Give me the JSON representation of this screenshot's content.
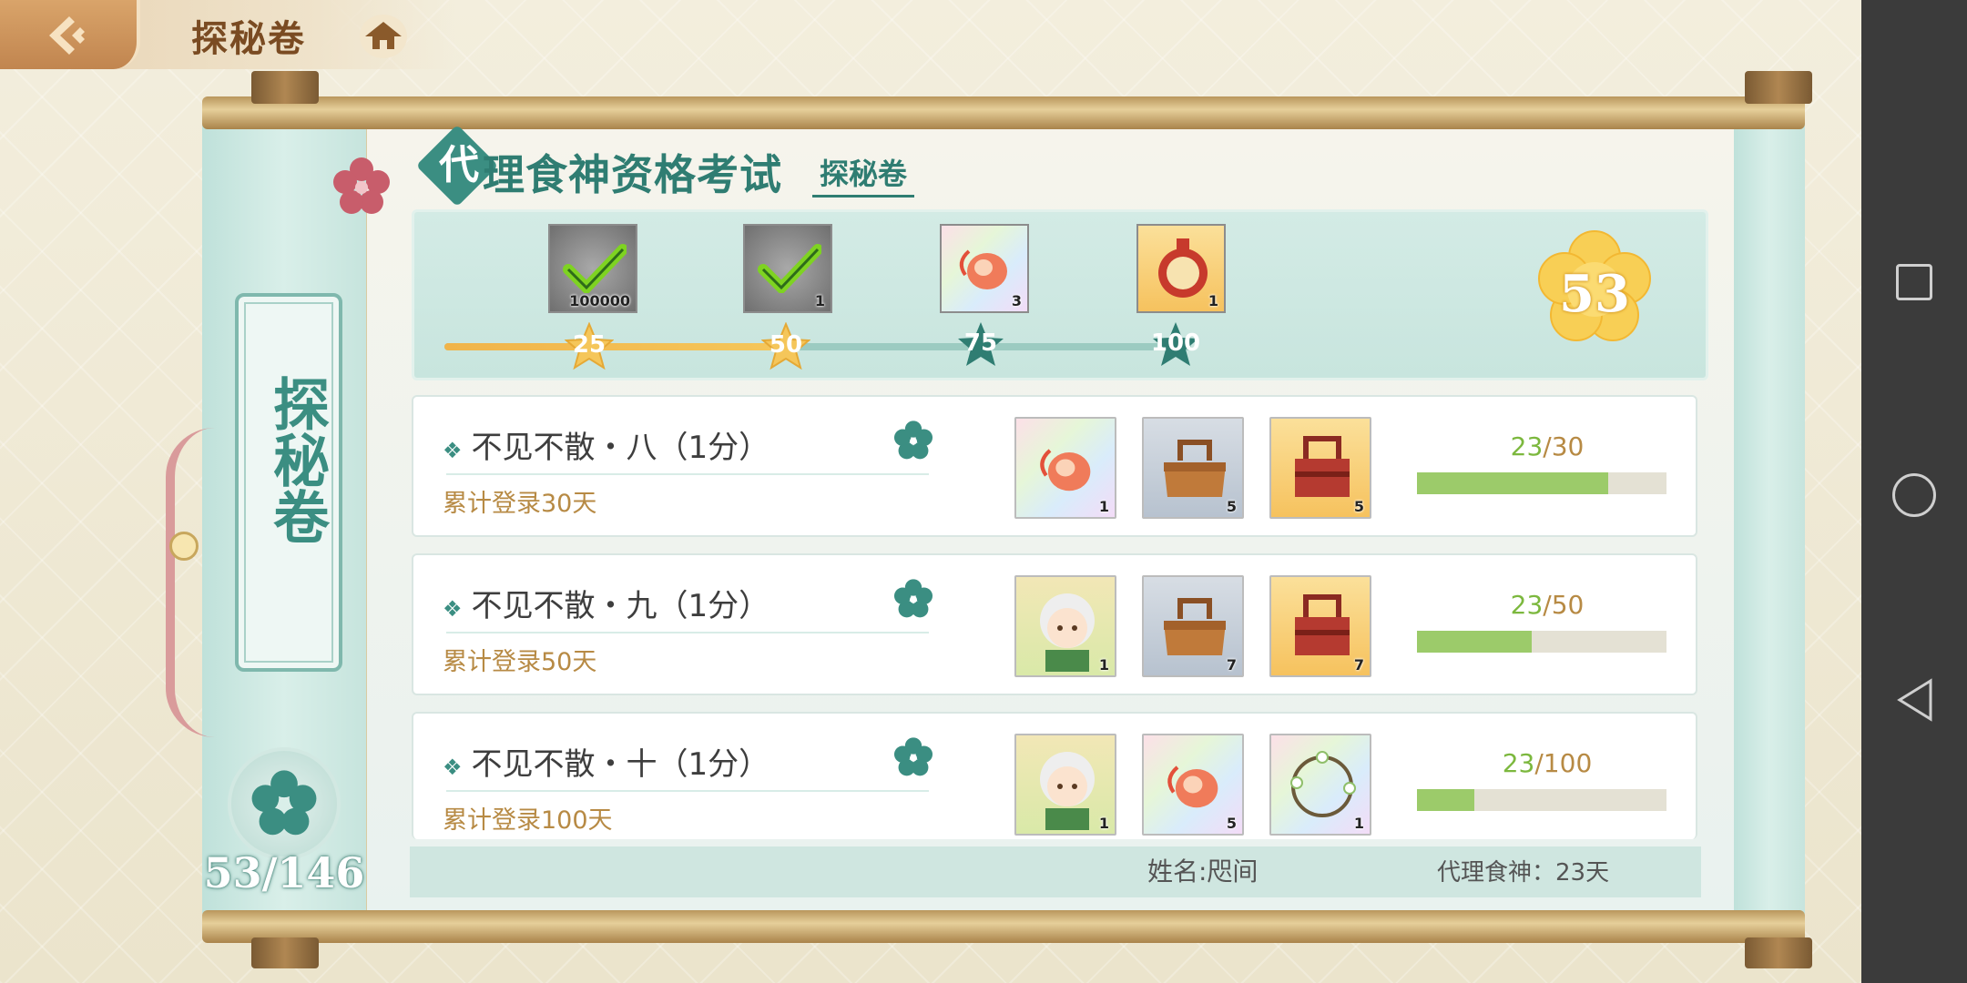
{
  "header": {
    "back_label": "返回",
    "title": "探秘卷"
  },
  "left_panel": {
    "vertical_title": "探秘卷",
    "progress": "53/146"
  },
  "main": {
    "title_first_char": "代",
    "title_rest": "理食神资格考试",
    "subtitle": "探秘卷"
  },
  "track": {
    "score": "53",
    "progress_fraction": 0.53,
    "milestones": [
      {
        "value": "25",
        "reached": true,
        "reward_icon": "check-token-icon",
        "count": "100000"
      },
      {
        "value": "50",
        "reached": true,
        "reward_icon": "check-token-icon",
        "count": "1"
      },
      {
        "value": "75",
        "reached": false,
        "reward_icon": "rainbow-spirit-icon",
        "count": "3"
      },
      {
        "value": "100",
        "reached": false,
        "reward_icon": "seal-medal-icon",
        "count": "1"
      }
    ]
  },
  "quests": [
    {
      "title": "不见不散・八（1分）",
      "desc": "累计登录30天",
      "current": "23",
      "total": "/30",
      "fraction": 0.7667,
      "rewards": [
        {
          "icon": "rainbow-spirit-icon",
          "count": "1"
        },
        {
          "icon": "wooden-food-box-icon",
          "count": "5"
        },
        {
          "icon": "red-food-box-icon",
          "count": "5"
        }
      ]
    },
    {
      "title": "不见不散・九（1分）",
      "desc": "累计登录50天",
      "current": "23",
      "total": "/50",
      "fraction": 0.46,
      "rewards": [
        {
          "icon": "character-portrait-icon",
          "count": "1"
        },
        {
          "icon": "wooden-food-box-icon",
          "count": "7"
        },
        {
          "icon": "red-food-box-icon",
          "count": "7"
        }
      ]
    },
    {
      "title": "不见不散・十（1分）",
      "desc": "累计登录100天",
      "current": "23",
      "total": "/100",
      "fraction": 0.23,
      "rewards": [
        {
          "icon": "character-portrait-icon",
          "count": "1"
        },
        {
          "icon": "rainbow-spirit-icon",
          "count": "5"
        },
        {
          "icon": "flower-wreath-icon",
          "count": "1"
        }
      ]
    }
  ],
  "footer": {
    "name": "姓名:咫间",
    "days": "代理食神：23天"
  },
  "colors": {
    "accent": "#3b8e82",
    "gold": "#f5c65a",
    "progress_green": "#9ccb6a"
  }
}
